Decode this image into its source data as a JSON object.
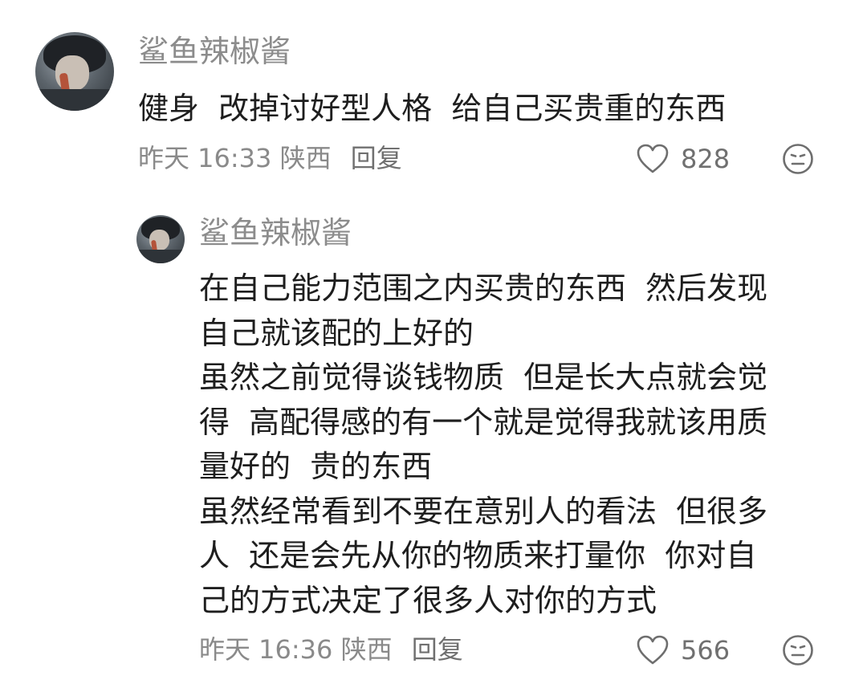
{
  "comments": [
    {
      "username": "鲨鱼辣椒酱",
      "text": "健身  改掉讨好型人格  给自己买贵重的东西",
      "time": "昨天 16:33",
      "location": "陕西",
      "reply_label": "回复",
      "likes": "828"
    },
    {
      "username": "鲨鱼辣椒酱",
      "lines": [
        "在自己能力范围之内买贵的东西  然后发现",
        "自己就该配的上好的",
        "虽然之前觉得谈钱物质  但是长大点就会觉",
        "得  高配得感的有一个就是觉得我就该用质",
        "量好的  贵的东西",
        "虽然经常看到不要在意别人的看法  但很多",
        "人  还是会先从你的物质来打量你  你对自",
        "己的方式决定了很多人对你的方式"
      ],
      "time": "昨天 16:36",
      "location": "陕西",
      "reply_label": "回复",
      "likes": "566"
    }
  ],
  "icons": {
    "like": "heart-outline",
    "dislike": "neutral-face"
  }
}
